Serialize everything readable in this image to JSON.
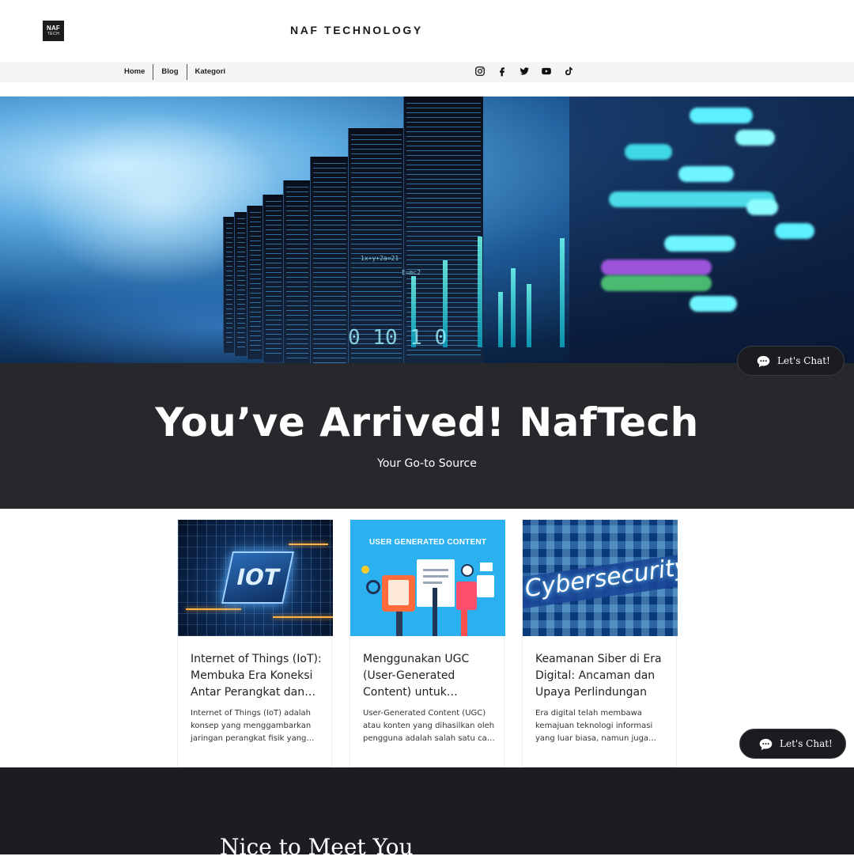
{
  "header": {
    "logo_line1": "NAF",
    "logo_line2": "TECH",
    "title": "NAF TECHNOLOGY"
  },
  "nav": {
    "items": [
      {
        "label": "Home"
      },
      {
        "label": "Blog"
      },
      {
        "label": "Kategori"
      }
    ],
    "socials": [
      "instagram-icon",
      "facebook-icon",
      "twitter-icon",
      "youtube-icon",
      "tiktok-icon"
    ]
  },
  "hero": {
    "code_1": "0 10 1 0",
    "code_2": "1x+y+2a=21",
    "code_3": "E=mc2"
  },
  "banner": {
    "title": "You’ve Arrived! NafTech",
    "subtitle": "Your Go-to Source"
  },
  "posts": [
    {
      "image_text": "IOT",
      "title": "Internet of Things (IoT): Membuka Era Koneksi Antar Perangkat dan…",
      "excerpt": "Internet of Things (IoT) adalah konsep yang menggambarkan jaringan perangkat fisik yang…"
    },
    {
      "image_text": "USER GENERATED CONTENT",
      "title": "Menggunakan UGC (User-Generated Content) untuk…",
      "excerpt": "User-Generated Content (UGC) atau konten yang dihasilkan oleh pengguna adalah salah satu ca…"
    },
    {
      "image_text": "Cybersecurity",
      "title": "Keamanan Siber di Era Digital: Ancaman dan Upaya Perlindungan",
      "excerpt": "Era digital telah membawa kemajuan teknologi informasi yang luar biasa, namun juga…"
    }
  ],
  "footer": {
    "heading": "Nice to Meet You"
  },
  "chat": {
    "label": "Let's Chat!"
  },
  "colors": {
    "banner_bg": "#27282c",
    "footer_bg": "#1c1d22",
    "nav_bg": "#f5f5f5",
    "ugc_blue": "#2bb0f0"
  }
}
